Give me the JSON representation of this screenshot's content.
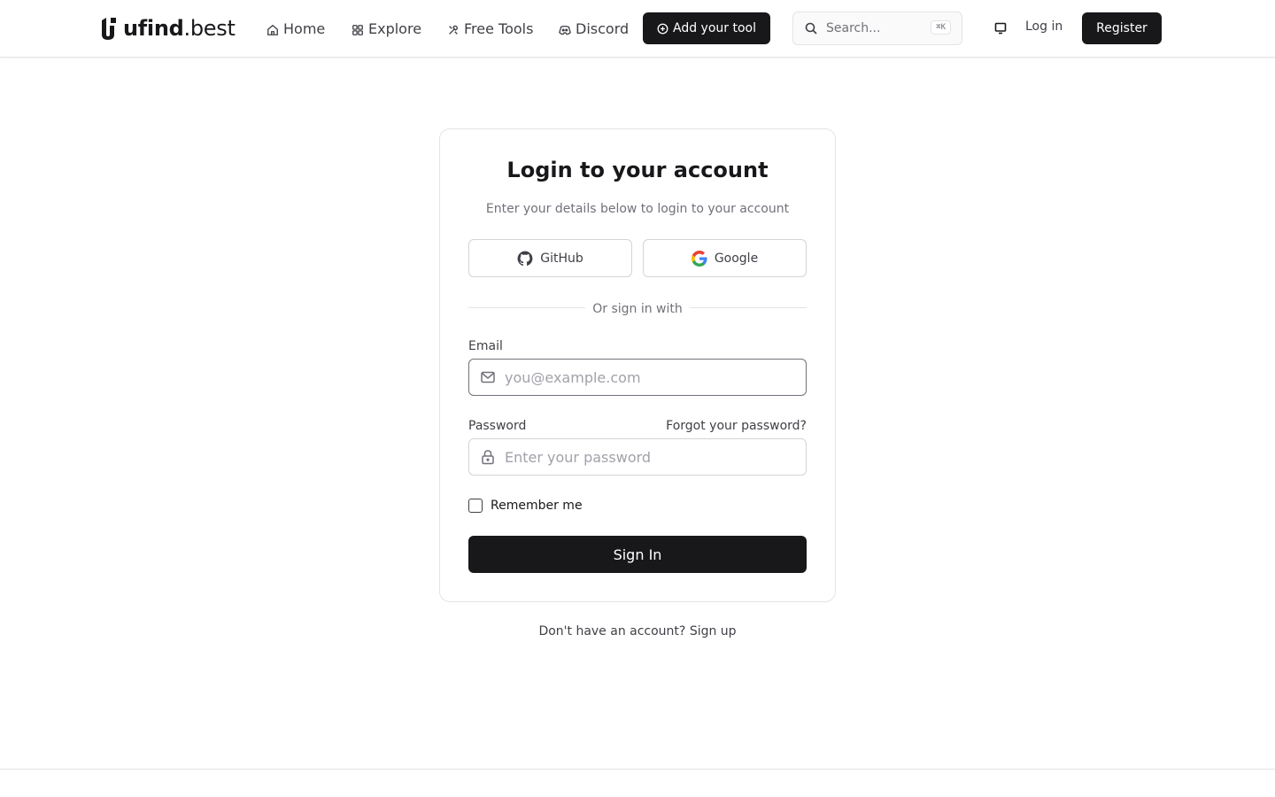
{
  "header": {
    "logo": {
      "strong": "ufind",
      "light": ".best"
    },
    "nav": [
      {
        "label": "Home",
        "icon": "home-icon"
      },
      {
        "label": "Explore",
        "icon": "grid-icon"
      },
      {
        "label": "Free Tools",
        "icon": "tools-icon"
      },
      {
        "label": "Discord",
        "icon": "discord-icon"
      }
    ],
    "add_tool_label": "Add your tool",
    "search": {
      "placeholder": "Search...",
      "shortcut": "⌘K"
    },
    "login_label": "Log in",
    "register_label": "Register"
  },
  "login": {
    "title": "Login to your account",
    "subtitle": "Enter your details below to login to your account",
    "github_label": "GitHub",
    "google_label": "Google",
    "divider_label": "Or sign in with",
    "email_label": "Email",
    "email_placeholder": "you@example.com",
    "password_label": "Password",
    "forgot_label": "Forgot your password?",
    "password_placeholder": "Enter your password",
    "remember_label": "Remember me",
    "remember_checked": false,
    "submit_label": "Sign In",
    "signup_prompt": "Don't have an account?",
    "signup_link": "Sign up"
  },
  "colors": {
    "primary": "#18181b",
    "border": "#e4e4e7",
    "muted_text": "#71717a"
  }
}
